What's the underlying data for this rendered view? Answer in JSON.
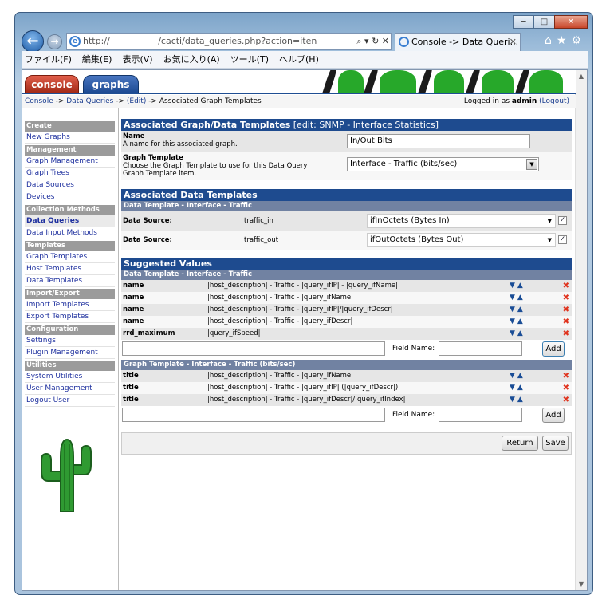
{
  "window": {
    "min": "─",
    "max": "□",
    "close": "✕"
  },
  "browser": {
    "url": "http://           /cacti/data_queries.php?action=iten",
    "addr_ctl": "⌕ ▾ ↻ ✕",
    "tab_title": "Console -> Data Queri...",
    "tab_close": "✕",
    "back": "←",
    "forward": "→",
    "tools": "⌂★⚙"
  },
  "menu": [
    "ファイル(F)",
    "編集(E)",
    "表示(V)",
    "お気に入り(A)",
    "ツール(T)",
    "ヘルプ(H)"
  ],
  "tabs": {
    "console": "console",
    "graphs": "graphs"
  },
  "breadcrumb": {
    "console": "Console",
    "sep1": " -> ",
    "dq": "Data Queries",
    "sep2": " -> ",
    "edit": "(Edit)",
    "sep3": " -> ",
    "current": "Associated Graph Templates",
    "logged_pre": "Logged in as ",
    "user": "admin",
    "logout": "(Logout)"
  },
  "sidebar": [
    {
      "h": "Create"
    },
    {
      "i": "New Graphs"
    },
    {
      "h": "Management"
    },
    {
      "i": "Graph Management"
    },
    {
      "i": "Graph Trees"
    },
    {
      "i": "Data Sources"
    },
    {
      "i": "Devices"
    },
    {
      "h": "Collection Methods"
    },
    {
      "i": "Data Queries",
      "sel": true
    },
    {
      "i": "Data Input Methods"
    },
    {
      "h": "Templates"
    },
    {
      "i": "Graph Templates"
    },
    {
      "i": "Host Templates"
    },
    {
      "i": "Data Templates"
    },
    {
      "h": "Import/Export"
    },
    {
      "i": "Import Templates"
    },
    {
      "i": "Export Templates"
    },
    {
      "h": "Configuration"
    },
    {
      "i": "Settings"
    },
    {
      "i": "Plugin Management"
    },
    {
      "h": "Utilities"
    },
    {
      "i": "System Utilities"
    },
    {
      "i": "User Management"
    },
    {
      "i": "Logout User"
    }
  ],
  "assoc": {
    "title": "Associated Graph/Data Templates",
    "edit": " [edit: SNMP - Interface Statistics]",
    "name_label": "Name",
    "name_desc": "A name for this associated graph.",
    "name_value": "In/Out Bits",
    "gt_label": "Graph Template",
    "gt_desc1": "Choose the Graph Template to use for this Data Query",
    "gt_desc2": "Graph Template item.",
    "gt_value": "Interface - Traffic (bits/sec)"
  },
  "adt": {
    "title": "Associated Data Templates",
    "sub": "Data Template - Interface - Traffic",
    "rows": [
      {
        "label": "Data Source:",
        "name": "traffic_in",
        "value": "ifInOctets (Bytes In)",
        "check": "✓"
      },
      {
        "label": "Data Source:",
        "name": "traffic_out",
        "value": "ifOutOctets (Bytes Out)",
        "check": "✓"
      }
    ]
  },
  "suggested": {
    "title": "Suggested Values",
    "sub1": "Data Template - Interface - Traffic",
    "rows1": [
      {
        "f": "name",
        "v": "|host_description| - Traffic - |query_ifIP| - |query_ifName|"
      },
      {
        "f": "name",
        "v": "|host_description| - Traffic - |query_ifName|"
      },
      {
        "f": "name",
        "v": "|host_description| - Traffic - |query_ifIP|/|query_ifDescr|"
      },
      {
        "f": "name",
        "v": "|host_description| - Traffic - |query_ifDescr|"
      },
      {
        "f": "rrd_maximum",
        "v": "|query_ifSpeed|"
      }
    ],
    "sub2": "Graph Template - Interface - Traffic (bits/sec)",
    "rows2": [
      {
        "f": "title",
        "v": "|host_description| - Traffic - |query_ifName|"
      },
      {
        "f": "title",
        "v": "|host_description| - Traffic - |query_ifIP| (|query_ifDescr|)"
      },
      {
        "f": "title",
        "v": "|host_description| - Traffic - |query_ifDescr|/|query_ifIndex|"
      }
    ],
    "arrows": "🡇🡅",
    "del": "✖",
    "field_name": "Field Name:",
    "add": "Add"
  },
  "buttons": {
    "return": "Return",
    "save": "Save"
  },
  "dropdown_arrow": "▼"
}
